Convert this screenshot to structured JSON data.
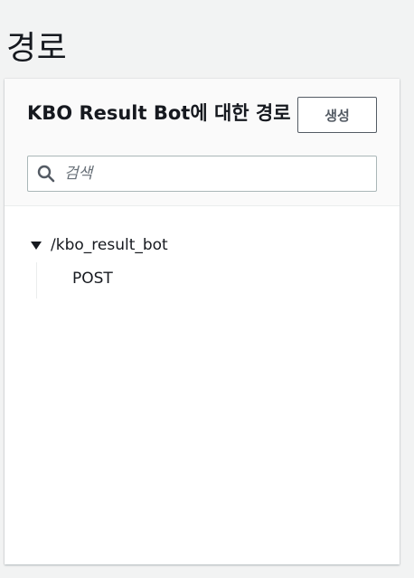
{
  "page": {
    "title": "경로"
  },
  "panel": {
    "title": "KBO Result Bot에 대한 경로",
    "create_button_label": "생성",
    "search": {
      "placeholder": "검색",
      "value": ""
    }
  },
  "tree": {
    "resource": {
      "path": "/kbo_result_bot",
      "expanded": true,
      "methods": [
        "POST"
      ]
    }
  },
  "icons": {
    "search": "search-icon",
    "caret": "caret-down-icon"
  },
  "colors": {
    "page_background": "#f2f3f3",
    "panel_background": "#ffffff",
    "header_background": "#fafafa",
    "text": "#16191f",
    "button_border": "#545b64",
    "input_border": "#aab7b8",
    "placeholder": "#687078"
  }
}
